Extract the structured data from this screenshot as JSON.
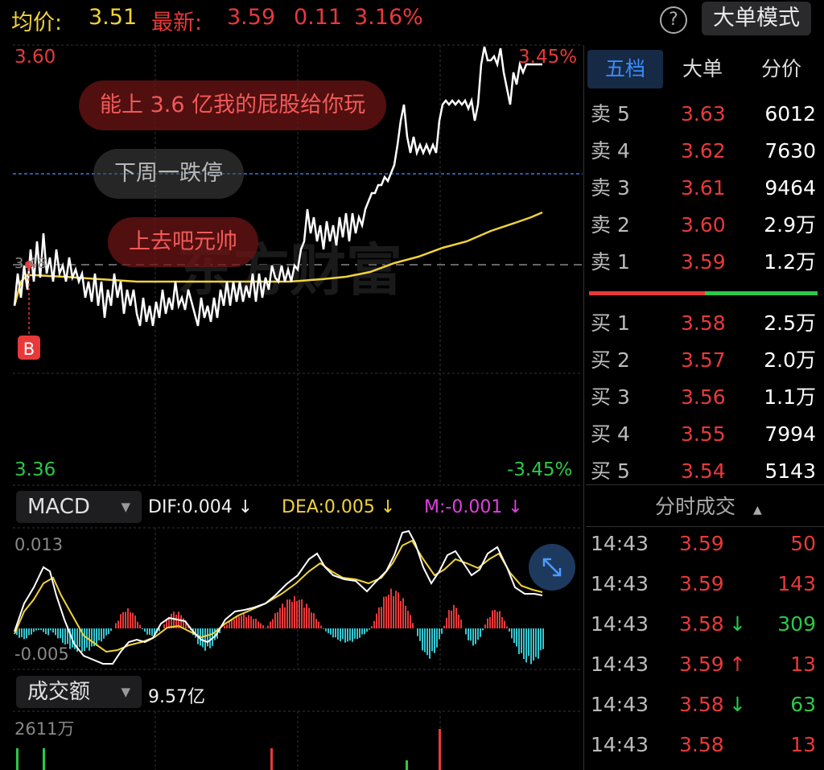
{
  "header": {
    "avg_label": "均价:",
    "avg_value": "3.51",
    "latest_label": "最新:",
    "latest_price": "3.59",
    "change": "0.11",
    "change_pct": "3.16%",
    "mode_button": "大单模式",
    "help_icon": "question-icon"
  },
  "chart": {
    "price_high": "3.60",
    "price_low": "3.36",
    "pct_high": "3.45%",
    "pct_low": "-3.45%",
    "prev_close_label": "3.48",
    "buy_marker": "B",
    "watermark": "东方财富",
    "comments": [
      "能上 3.6 亿我的屁股给你玩",
      "下周一跌停",
      "上去吧元帅"
    ]
  },
  "macd": {
    "selector": "MACD",
    "dif": "DIF:0.004 ↓",
    "dea": "DEA:0.005 ↓",
    "m": "M:-0.001 ↓",
    "y_top": "0.013",
    "y_bottom": "-0.005"
  },
  "volume": {
    "selector": "成交额",
    "total": "9.57亿",
    "y_top": "2611万"
  },
  "right_panel": {
    "tabs": [
      "五档",
      "大单",
      "分价"
    ],
    "sells": [
      {
        "label": "卖 5",
        "price": "3.63",
        "vol": "6012"
      },
      {
        "label": "卖 4",
        "price": "3.62",
        "vol": "7630"
      },
      {
        "label": "卖 3",
        "price": "3.61",
        "vol": "9464"
      },
      {
        "label": "卖 2",
        "price": "3.60",
        "vol": "2.9万"
      },
      {
        "label": "卖 1",
        "price": "3.59",
        "vol": "1.2万"
      }
    ],
    "buys": [
      {
        "label": "买 1",
        "price": "3.58",
        "vol": "2.5万"
      },
      {
        "label": "买 2",
        "price": "3.57",
        "vol": "2.0万"
      },
      {
        "label": "买 3",
        "price": "3.56",
        "vol": "1.1万"
      },
      {
        "label": "买 4",
        "price": "3.55",
        "vol": "7994"
      },
      {
        "label": "买 5",
        "price": "3.54",
        "vol": "5143"
      }
    ],
    "trades_title": "分时成交",
    "trades": [
      {
        "time": "14:43",
        "price": "3.59",
        "arrow": "",
        "vol": "50",
        "vol_color": "#e8393a"
      },
      {
        "time": "14:43",
        "price": "3.59",
        "arrow": "",
        "vol": "143",
        "vol_color": "#e8393a"
      },
      {
        "time": "14:43",
        "price": "3.58",
        "arrow": "↓",
        "vol": "309",
        "vol_color": "#2cc84a"
      },
      {
        "time": "14:43",
        "price": "3.59",
        "arrow": "↑",
        "vol": "13",
        "vol_color": "#e8393a"
      },
      {
        "time": "14:43",
        "price": "3.58",
        "arrow": "↓",
        "vol": "63",
        "vol_color": "#2cc84a"
      },
      {
        "time": "14:43",
        "price": "3.58",
        "arrow": "",
        "vol": "13",
        "vol_color": "#e8393a"
      }
    ]
  },
  "colors": {
    "up": "#e8393a",
    "down": "#2cc84a",
    "avg": "#f1d33a",
    "dea": "#f1d33a",
    "m": "#e040e0",
    "tab_active": "#2f7df0"
  }
}
